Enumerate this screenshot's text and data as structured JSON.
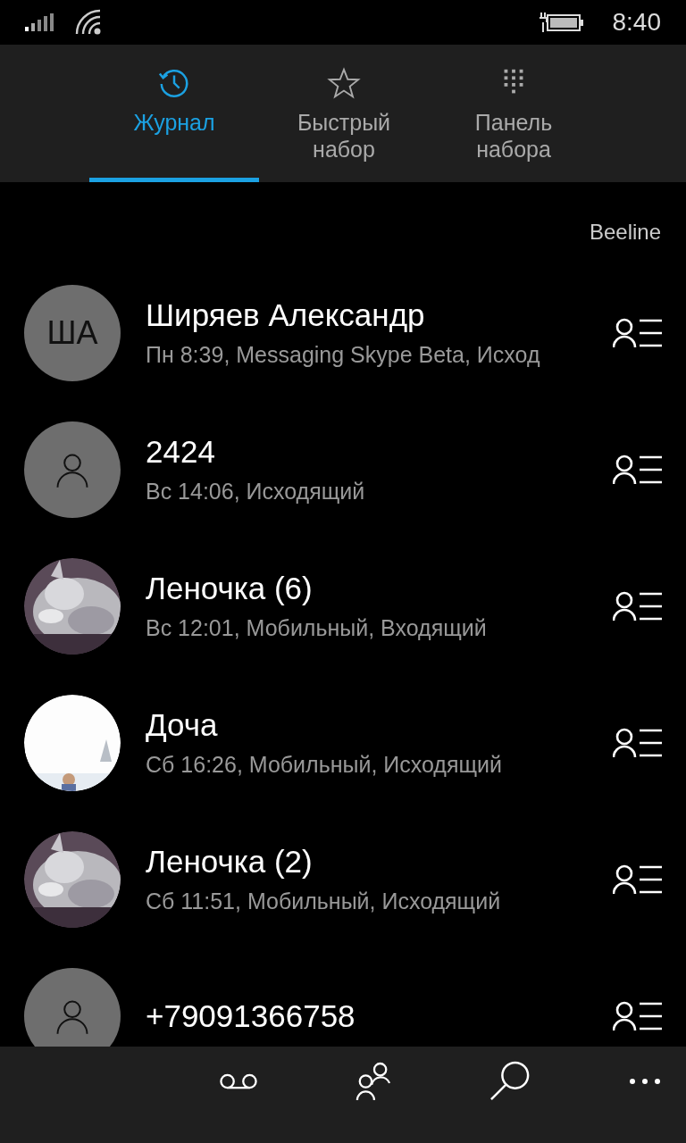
{
  "status_bar": {
    "time": "8:40"
  },
  "tabs": [
    {
      "label": "Журнал",
      "selected": true
    },
    {
      "label": "Быстрый набор",
      "selected": false
    },
    {
      "label": "Панель набора",
      "selected": false
    }
  ],
  "carrier": "Beeline",
  "calls": [
    {
      "avatar": {
        "kind": "initials",
        "initials": "ША"
      },
      "name": "Ширяев Александр",
      "detail": "Пн 8:39, Messaging Skype Beta, Исход"
    },
    {
      "avatar": {
        "kind": "placeholder"
      },
      "name": "2424",
      "detail": "Вс 14:06, Исходящий"
    },
    {
      "name": "Леночка (6)",
      "detail": "Вс 12:01, Мобильный, Входящий"
    },
    {
      "avatar": {
        "kind": "snow"
      },
      "name": "Доча",
      "detail": "Сб 16:26, Мобильный, Исходящий"
    },
    {
      "name": "Леночка (2)",
      "detail": "Сб 11:51, Мобильный, Исходящий"
    },
    {
      "avatar": {
        "kind": "placeholder"
      },
      "name": "+79091366758"
    }
  ]
}
